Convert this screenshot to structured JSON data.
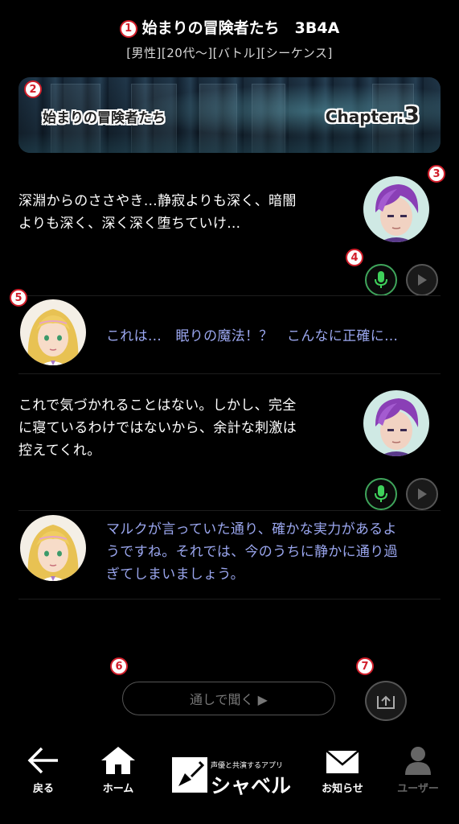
{
  "header": {
    "marker": "1",
    "title": "始まりの冒険者たち　3B4A",
    "tags": "[男性][20代〜][バトル][シーケンス]"
  },
  "banner": {
    "marker": "2",
    "title": "始まりの冒険者たち",
    "chapter_label": "Chapter:",
    "chapter_num": "3"
  },
  "messages": [
    {
      "marker": "3",
      "speaker": "villain",
      "lines": [
        "深淵からのささやき…静寂よりも深く、暗闇",
        "よりも深く、深く深く堕ちていけ…"
      ]
    },
    {
      "marker": "5",
      "speaker": "heroine",
      "lines": [
        "これは…　眠りの魔法！？　こんなに正確に…"
      ]
    },
    {
      "speaker": "villain",
      "lines": [
        "これで気づかれることはない。しかし、完全",
        "に寝ているわけではないから、余計な刺激は",
        "控えてくれ。"
      ]
    },
    {
      "speaker": "heroine",
      "lines": [
        "マルクが言っていた通り、確かな実力があるよ",
        "うですね。それでは、今のうちに静かに通り過",
        "ぎてしまいましょう。"
      ]
    }
  ],
  "controls": {
    "marker_audio": "4",
    "marker_listen": "6",
    "marker_share": "7",
    "listen_all_label": "通しで聞く ▶"
  },
  "nav": {
    "back": "戻る",
    "home": "ホーム",
    "app_tagline": "声優と共演するアプリ",
    "app_name": "シャベル",
    "notifications": "お知らせ",
    "user": "ユーザー"
  }
}
